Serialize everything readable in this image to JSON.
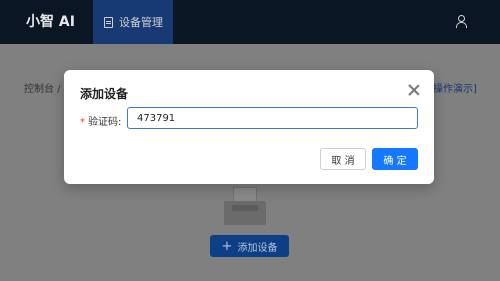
{
  "header": {
    "brand": "小智 AI",
    "nav_items": [
      {
        "label": "设备管理",
        "icon": "document-icon",
        "active": true
      }
    ],
    "user_icon": "user-icon"
  },
  "page": {
    "breadcrumb": "控制台 /",
    "demo_link": "操作演示]",
    "empty_state_icon": "empty-box-icon",
    "add_device_label": "添加设备"
  },
  "dialog": {
    "title": "添加设备",
    "field_label": "验证码:",
    "required_mark": "*",
    "code_value": "473791",
    "cancel_label": "取 消",
    "confirm_label": "确 定"
  },
  "colors": {
    "primary": "#1677ff",
    "required": "#e23c3c",
    "nav_bg": "#0b1624"
  }
}
